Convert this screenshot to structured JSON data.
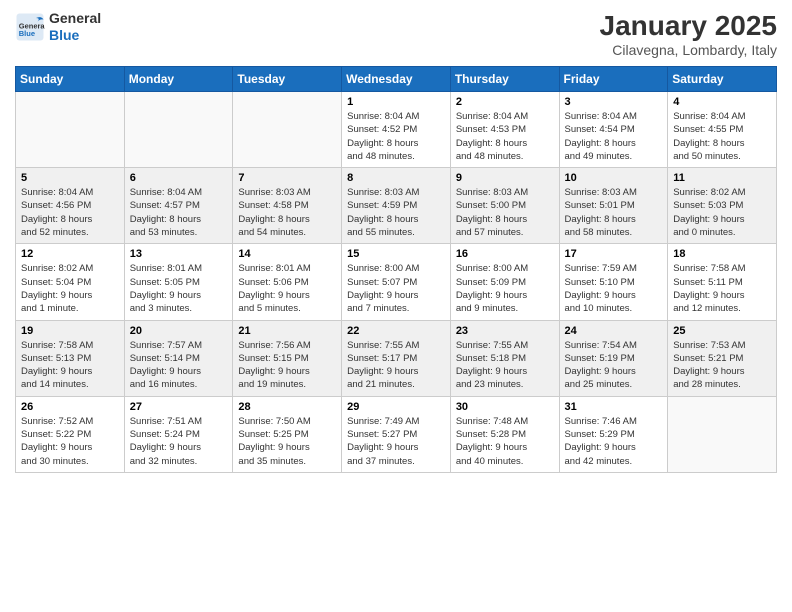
{
  "header": {
    "logo": {
      "general": "General",
      "blue": "Blue"
    },
    "title": "January 2025",
    "location": "Cilavegna, Lombardy, Italy"
  },
  "calendar": {
    "days_of_week": [
      "Sunday",
      "Monday",
      "Tuesday",
      "Wednesday",
      "Thursday",
      "Friday",
      "Saturday"
    ],
    "weeks": [
      [
        {
          "day": "",
          "info": ""
        },
        {
          "day": "",
          "info": ""
        },
        {
          "day": "",
          "info": ""
        },
        {
          "day": "1",
          "info": "Sunrise: 8:04 AM\nSunset: 4:52 PM\nDaylight: 8 hours\nand 48 minutes."
        },
        {
          "day": "2",
          "info": "Sunrise: 8:04 AM\nSunset: 4:53 PM\nDaylight: 8 hours\nand 48 minutes."
        },
        {
          "day": "3",
          "info": "Sunrise: 8:04 AM\nSunset: 4:54 PM\nDaylight: 8 hours\nand 49 minutes."
        },
        {
          "day": "4",
          "info": "Sunrise: 8:04 AM\nSunset: 4:55 PM\nDaylight: 8 hours\nand 50 minutes."
        }
      ],
      [
        {
          "day": "5",
          "info": "Sunrise: 8:04 AM\nSunset: 4:56 PM\nDaylight: 8 hours\nand 52 minutes."
        },
        {
          "day": "6",
          "info": "Sunrise: 8:04 AM\nSunset: 4:57 PM\nDaylight: 8 hours\nand 53 minutes."
        },
        {
          "day": "7",
          "info": "Sunrise: 8:03 AM\nSunset: 4:58 PM\nDaylight: 8 hours\nand 54 minutes."
        },
        {
          "day": "8",
          "info": "Sunrise: 8:03 AM\nSunset: 4:59 PM\nDaylight: 8 hours\nand 55 minutes."
        },
        {
          "day": "9",
          "info": "Sunrise: 8:03 AM\nSunset: 5:00 PM\nDaylight: 8 hours\nand 57 minutes."
        },
        {
          "day": "10",
          "info": "Sunrise: 8:03 AM\nSunset: 5:01 PM\nDaylight: 8 hours\nand 58 minutes."
        },
        {
          "day": "11",
          "info": "Sunrise: 8:02 AM\nSunset: 5:03 PM\nDaylight: 9 hours\nand 0 minutes."
        }
      ],
      [
        {
          "day": "12",
          "info": "Sunrise: 8:02 AM\nSunset: 5:04 PM\nDaylight: 9 hours\nand 1 minute."
        },
        {
          "day": "13",
          "info": "Sunrise: 8:01 AM\nSunset: 5:05 PM\nDaylight: 9 hours\nand 3 minutes."
        },
        {
          "day": "14",
          "info": "Sunrise: 8:01 AM\nSunset: 5:06 PM\nDaylight: 9 hours\nand 5 minutes."
        },
        {
          "day": "15",
          "info": "Sunrise: 8:00 AM\nSunset: 5:07 PM\nDaylight: 9 hours\nand 7 minutes."
        },
        {
          "day": "16",
          "info": "Sunrise: 8:00 AM\nSunset: 5:09 PM\nDaylight: 9 hours\nand 9 minutes."
        },
        {
          "day": "17",
          "info": "Sunrise: 7:59 AM\nSunset: 5:10 PM\nDaylight: 9 hours\nand 10 minutes."
        },
        {
          "day": "18",
          "info": "Sunrise: 7:58 AM\nSunset: 5:11 PM\nDaylight: 9 hours\nand 12 minutes."
        }
      ],
      [
        {
          "day": "19",
          "info": "Sunrise: 7:58 AM\nSunset: 5:13 PM\nDaylight: 9 hours\nand 14 minutes."
        },
        {
          "day": "20",
          "info": "Sunrise: 7:57 AM\nSunset: 5:14 PM\nDaylight: 9 hours\nand 16 minutes."
        },
        {
          "day": "21",
          "info": "Sunrise: 7:56 AM\nSunset: 5:15 PM\nDaylight: 9 hours\nand 19 minutes."
        },
        {
          "day": "22",
          "info": "Sunrise: 7:55 AM\nSunset: 5:17 PM\nDaylight: 9 hours\nand 21 minutes."
        },
        {
          "day": "23",
          "info": "Sunrise: 7:55 AM\nSunset: 5:18 PM\nDaylight: 9 hours\nand 23 minutes."
        },
        {
          "day": "24",
          "info": "Sunrise: 7:54 AM\nSunset: 5:19 PM\nDaylight: 9 hours\nand 25 minutes."
        },
        {
          "day": "25",
          "info": "Sunrise: 7:53 AM\nSunset: 5:21 PM\nDaylight: 9 hours\nand 28 minutes."
        }
      ],
      [
        {
          "day": "26",
          "info": "Sunrise: 7:52 AM\nSunset: 5:22 PM\nDaylight: 9 hours\nand 30 minutes."
        },
        {
          "day": "27",
          "info": "Sunrise: 7:51 AM\nSunset: 5:24 PM\nDaylight: 9 hours\nand 32 minutes."
        },
        {
          "day": "28",
          "info": "Sunrise: 7:50 AM\nSunset: 5:25 PM\nDaylight: 9 hours\nand 35 minutes."
        },
        {
          "day": "29",
          "info": "Sunrise: 7:49 AM\nSunset: 5:27 PM\nDaylight: 9 hours\nand 37 minutes."
        },
        {
          "day": "30",
          "info": "Sunrise: 7:48 AM\nSunset: 5:28 PM\nDaylight: 9 hours\nand 40 minutes."
        },
        {
          "day": "31",
          "info": "Sunrise: 7:46 AM\nSunset: 5:29 PM\nDaylight: 9 hours\nand 42 minutes."
        },
        {
          "day": "",
          "info": ""
        }
      ]
    ]
  }
}
